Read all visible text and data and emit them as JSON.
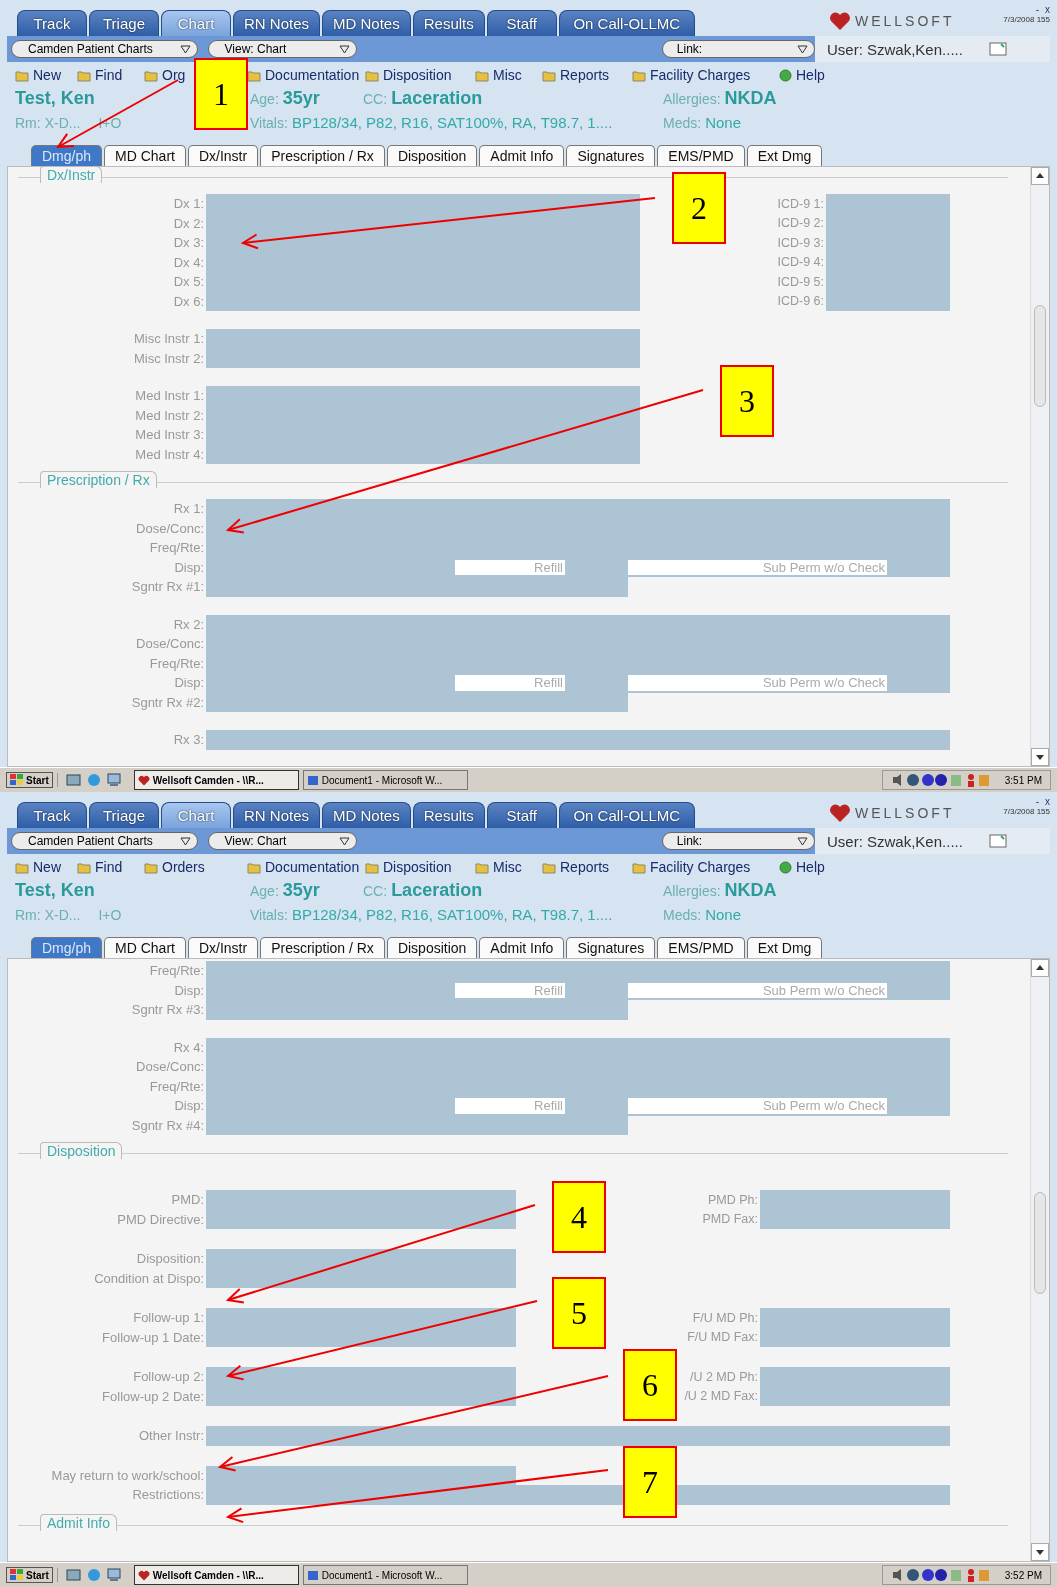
{
  "screens": [
    {
      "tabs": [
        {
          "label": "Track",
          "selected": false
        },
        {
          "label": "Triage",
          "selected": false
        },
        {
          "label": "Chart",
          "selected": true
        },
        {
          "label": "RN Notes",
          "selected": false
        },
        {
          "label": "MD Notes",
          "selected": false
        },
        {
          "label": "Results",
          "selected": false
        },
        {
          "label": "Staff",
          "selected": false
        },
        {
          "label": "On Call-OLLMC",
          "selected": false
        }
      ],
      "logo": "WELLSOFT",
      "date": "7/3/2008 155",
      "window_controls": [
        "-",
        "x"
      ],
      "dropdowns": [
        "Camden Patient Charts",
        "View: Chart"
      ],
      "link_dropdown": "Link:",
      "user": "User: Szwak,Ken.....",
      "menu": [
        "New",
        "Find",
        "Org",
        "Documentation",
        "Disposition",
        "Misc",
        "Reports",
        "Facility Charges",
        "Help"
      ],
      "patient": {
        "name": "Test, Ken",
        "age_label": "Age:",
        "age": "35yr",
        "cc_label": "CC:",
        "cc": "Laceration",
        "allergies_label": "Allergies:",
        "allergies": "NKDA",
        "room_label": "Rm:",
        "room": "X-D...",
        "io": "I+O",
        "vitals_label": "Vitals:",
        "vitals": "BP128/34, P82, R16, SAT100%, RA, T98.7, 1....",
        "meds_label": "Meds:",
        "meds": "None"
      },
      "subtabs": [
        {
          "label": "Dmg/ph",
          "selected": true
        },
        {
          "label": "MD Chart",
          "selected": false
        },
        {
          "label": "Dx/Instr",
          "selected": false
        },
        {
          "label": "Prescription / Rx",
          "selected": false
        },
        {
          "label": "Disposition",
          "selected": false
        },
        {
          "label": "Admit Info",
          "selected": false
        },
        {
          "label": "Signatures",
          "selected": false
        },
        {
          "label": "EMS/PMD",
          "selected": false
        },
        {
          "label": "Ext Dmg",
          "selected": false
        }
      ],
      "content": [
        {
          "kind": "section",
          "title": "Dx/Instr"
        },
        {
          "kind": "group",
          "rows": [
            {
              "label": "Dx 1:",
              "kind": "wide"
            },
            {
              "label": "Dx 2:",
              "kind": "wide"
            },
            {
              "label": "Dx 3:",
              "kind": "wide"
            },
            {
              "label": "Dx 4:",
              "kind": "wide"
            },
            {
              "label": "Dx 5:",
              "kind": "wide"
            },
            {
              "label": "Dx 6:",
              "kind": "wide"
            }
          ],
          "right": [
            {
              "label": "ICD-9 1:",
              "kind": "narrow"
            },
            {
              "label": "ICD-9 2:",
              "kind": "narrow"
            },
            {
              "label": "ICD-9 3:",
              "kind": "narrow"
            },
            {
              "label": "ICD-9 4:",
              "kind": "narrow"
            },
            {
              "label": "ICD-9 5:",
              "kind": "narrow"
            },
            {
              "label": "ICD-9 6:",
              "kind": "narrow"
            }
          ]
        },
        {
          "kind": "group",
          "rows": [
            {
              "label": "Misc Instr 1:",
              "kind": "wide"
            },
            {
              "label": "Misc Instr 2:",
              "kind": "wide"
            }
          ]
        },
        {
          "kind": "group",
          "rows": [
            {
              "label": "Med Instr 1:",
              "kind": "wide"
            },
            {
              "label": "Med Instr 2:",
              "kind": "wide"
            },
            {
              "label": "Med Instr 3:",
              "kind": "wide"
            },
            {
              "label": "Med Instr 4:",
              "kind": "wide"
            }
          ]
        },
        {
          "kind": "section",
          "title": "Prescription / Rx"
        },
        {
          "kind": "group",
          "rows": [
            {
              "label": "Rx 1:",
              "kind": "full"
            },
            {
              "label": "Dose/Conc:",
              "kind": "full"
            },
            {
              "label": "Freq/Rte:",
              "kind": "full"
            },
            {
              "label": "Disp:",
              "kind": "disp",
              "refill": "Refill",
              "subperm": "Sub Perm w/o Check"
            },
            {
              "label": "Sgntr Rx #1:",
              "kind": "sig"
            }
          ]
        },
        {
          "kind": "group",
          "rows": [
            {
              "label": "Rx 2:",
              "kind": "full"
            },
            {
              "label": "Dose/Conc:",
              "kind": "full"
            },
            {
              "label": "Freq/Rte:",
              "kind": "full"
            },
            {
              "label": "Disp:",
              "kind": "disp",
              "refill": "Refill",
              "subperm": "Sub Perm w/o Check"
            },
            {
              "label": "Sgntr Rx #2:",
              "kind": "sig"
            }
          ]
        },
        {
          "kind": "group",
          "rows": [
            {
              "label": "Rx 3:",
              "kind": "full"
            }
          ]
        }
      ],
      "taskbar": {
        "start": "Start",
        "tasks": [
          {
            "label": "Wellsoft Camden - \\\\R...",
            "selected": true
          },
          {
            "label": "Document1 - Microsoft W...",
            "selected": false
          }
        ],
        "time": "3:51 PM"
      }
    },
    {
      "tabs": [
        {
          "label": "Track",
          "selected": false
        },
        {
          "label": "Triage",
          "selected": false
        },
        {
          "label": "Chart",
          "selected": true
        },
        {
          "label": "RN Notes",
          "selected": false
        },
        {
          "label": "MD Notes",
          "selected": false
        },
        {
          "label": "Results",
          "selected": false
        },
        {
          "label": "Staff",
          "selected": false
        },
        {
          "label": "On Call-OLLMC",
          "selected": false
        }
      ],
      "logo": "WELLSOFT",
      "date": "7/3/2008 155",
      "window_controls": [
        "-",
        "x"
      ],
      "dropdowns": [
        "Camden Patient Charts",
        "View: Chart"
      ],
      "link_dropdown": "Link:",
      "user": "User: Szwak,Ken.....",
      "menu": [
        "New",
        "Find",
        "Orders",
        "Documentation",
        "Disposition",
        "Misc",
        "Reports",
        "Facility Charges",
        "Help"
      ],
      "patient": {
        "name": "Test, Ken",
        "age_label": "Age:",
        "age": "35yr",
        "cc_label": "CC:",
        "cc": "Laceration",
        "allergies_label": "Allergies:",
        "allergies": "NKDA",
        "room_label": "Rm:",
        "room": "X-D...",
        "io": "I+O",
        "vitals_label": "Vitals:",
        "vitals": "BP128/34, P82, R16, SAT100%, RA, T98.7, 1....",
        "meds_label": "Meds:",
        "meds": "None"
      },
      "subtabs": [
        {
          "label": "Dmg/ph",
          "selected": true
        },
        {
          "label": "MD Chart",
          "selected": false
        },
        {
          "label": "Dx/Instr",
          "selected": false
        },
        {
          "label": "Prescription / Rx",
          "selected": false
        },
        {
          "label": "Disposition",
          "selected": false
        },
        {
          "label": "Admit Info",
          "selected": false
        },
        {
          "label": "Signatures",
          "selected": false
        },
        {
          "label": "EMS/PMD",
          "selected": false
        },
        {
          "label": "Ext Dmg",
          "selected": false
        }
      ],
      "content": [
        {
          "kind": "group",
          "rows": [
            {
              "label": "Freq/Rte:",
              "kind": "full"
            },
            {
              "label": "Disp:",
              "kind": "disp",
              "refill": "Refill",
              "subperm": "Sub Perm w/o Check"
            },
            {
              "label": "Sgntr Rx #3:",
              "kind": "sig"
            }
          ]
        },
        {
          "kind": "group",
          "rows": [
            {
              "label": "Rx 4:",
              "kind": "full"
            },
            {
              "label": "Dose/Conc:",
              "kind": "full"
            },
            {
              "label": "Freq/Rte:",
              "kind": "full"
            },
            {
              "label": "Disp:",
              "kind": "disp",
              "refill": "Refill",
              "subperm": "Sub Perm w/o Check"
            },
            {
              "label": "Sgntr Rx #4:",
              "kind": "sig"
            }
          ]
        },
        {
          "kind": "section",
          "title": "Disposition"
        },
        {
          "kind": "group",
          "rows": [
            {
              "label": "PMD:",
              "kind": "half"
            },
            {
              "label": "PMD Directive:",
              "kind": "half"
            }
          ],
          "right": [
            {
              "label": "PMD Ph:",
              "kind": "wide"
            },
            {
              "label": "PMD Fax:",
              "kind": "wide"
            }
          ]
        },
        {
          "kind": "group",
          "rows": [
            {
              "label": "Disposition:",
              "kind": "half"
            },
            {
              "label": "Condition at Dispo:",
              "kind": "half"
            }
          ]
        },
        {
          "kind": "group",
          "rows": [
            {
              "label": "Follow-up 1:",
              "kind": "half"
            },
            {
              "label": "Follow-up 1 Date:",
              "kind": "half"
            }
          ],
          "right": [
            {
              "label": "F/U MD Ph:",
              "kind": "wide"
            },
            {
              "label": "F/U MD Fax:",
              "kind": "wide"
            }
          ]
        },
        {
          "kind": "group",
          "rows": [
            {
              "label": "Follow-up 2:",
              "kind": "half"
            },
            {
              "label": "Follow-up 2 Date:",
              "kind": "half"
            }
          ],
          "right": [
            {
              "label": "/U 2 MD Ph:",
              "kind": "wide"
            },
            {
              "label": "/U 2 MD Fax:",
              "kind": "wide"
            }
          ]
        },
        {
          "kind": "group",
          "rows": [
            {
              "label": "Other Instr:",
              "kind": "full"
            }
          ]
        },
        {
          "kind": "group",
          "rows": [
            {
              "label": "May return to work/school:",
              "kind": "half"
            },
            {
              "label": "Restrictions:",
              "kind": "full"
            }
          ]
        },
        {
          "kind": "section",
          "title": "Admit Info"
        }
      ],
      "taskbar": {
        "start": "Start",
        "tasks": [
          {
            "label": "Wellsoft Camden - \\\\R...",
            "selected": true
          },
          {
            "label": "Document1 - Microsoft W...",
            "selected": false
          }
        ],
        "time": "3:52 PM"
      }
    }
  ],
  "callouts": [
    {
      "label": "1"
    },
    {
      "label": "2"
    },
    {
      "label": "3"
    },
    {
      "label": "4"
    },
    {
      "label": "5"
    },
    {
      "label": "6"
    },
    {
      "label": "7"
    }
  ]
}
